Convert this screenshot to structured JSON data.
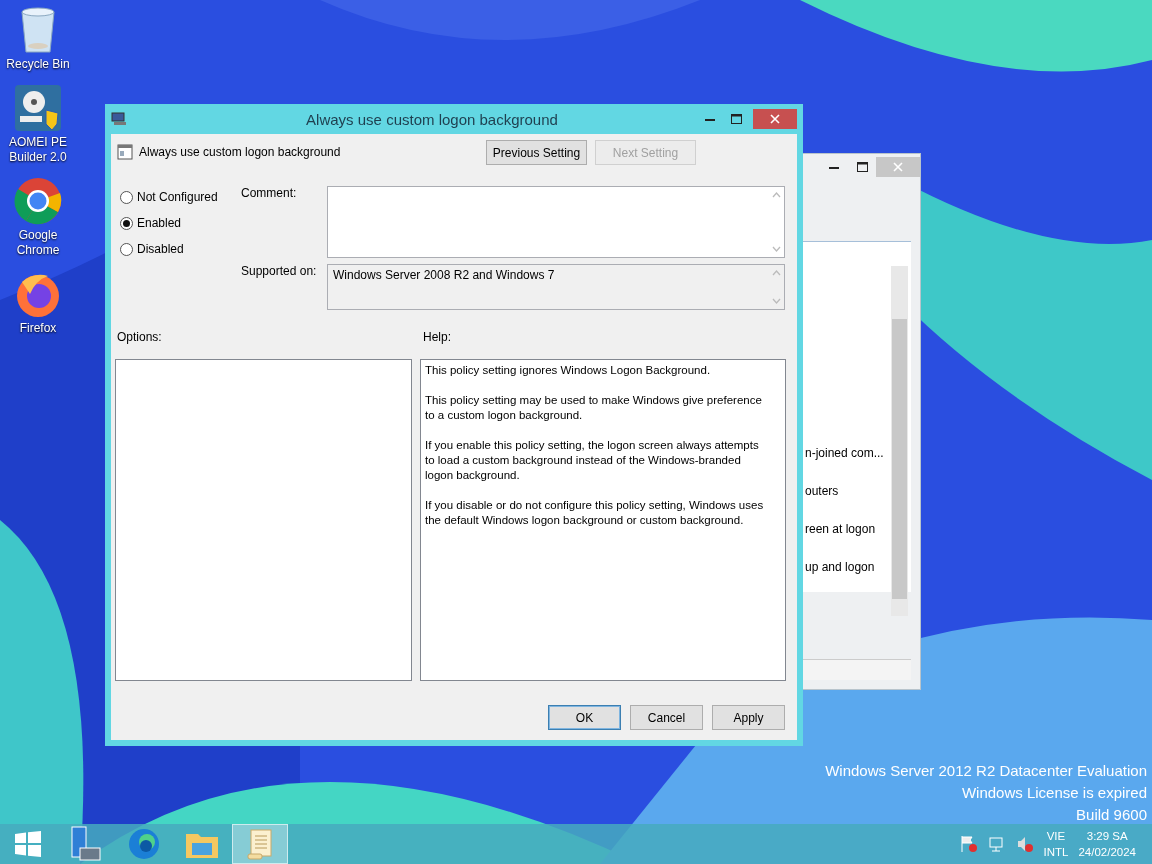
{
  "desktop_icons": [
    {
      "kind": "recycle",
      "label": "Recycle Bin"
    },
    {
      "kind": "aomei",
      "label": "AOMEI PE Builder 2.0"
    },
    {
      "kind": "chrome",
      "label": "Google Chrome"
    },
    {
      "kind": "firefox",
      "label": "Firefox"
    }
  ],
  "background_window": {
    "items": [
      "n-joined com...",
      "outers",
      "reen at logon",
      "up and logon"
    ]
  },
  "dialog": {
    "title": "Always use custom logon background",
    "setting_name": "Always use custom logon background",
    "nav_buttons": [
      {
        "label": "Previous Setting",
        "disabled": false
      },
      {
        "label": "Next Setting",
        "disabled": true
      }
    ],
    "states": [
      {
        "label": "Not Configured",
        "selected": false
      },
      {
        "label": "Enabled",
        "selected": true
      },
      {
        "label": "Disabled",
        "selected": false
      }
    ],
    "comment_label": "Comment:",
    "supported_label": "Supported on:",
    "supported_value": "Windows Server 2008 R2 and Windows 7",
    "options_label": "Options:",
    "help_label": "Help:",
    "help": [
      "This policy setting ignores Windows Logon Background.",
      "This policy setting may be used to make Windows give preference to a custom logon background.",
      "If you enable this policy setting, the logon screen always attempts to load a custom background instead of the Windows-branded logon background.",
      "If you disable or do not configure this policy setting, Windows uses the default Windows logon background or custom background."
    ],
    "buttons": [
      {
        "label": "OK",
        "default": true
      },
      {
        "label": "Cancel",
        "default": false
      },
      {
        "label": "Apply",
        "default": false
      }
    ]
  },
  "desktop_notice": [
    "Windows Server 2012 R2 Datacenter Evaluation",
    "Windows License is expired",
    "Build 9600"
  ],
  "taskbar": {
    "apps": [
      {
        "kind": "start",
        "selected": false
      },
      {
        "kind": "server-manager",
        "selected": false
      },
      {
        "kind": "edge",
        "selected": false
      },
      {
        "kind": "explorer",
        "selected": false
      },
      {
        "kind": "policy-editor",
        "selected": true
      }
    ],
    "language": [
      "VIE",
      "INTL"
    ],
    "time": "3:29 SA",
    "date": "24/02/2024"
  }
}
